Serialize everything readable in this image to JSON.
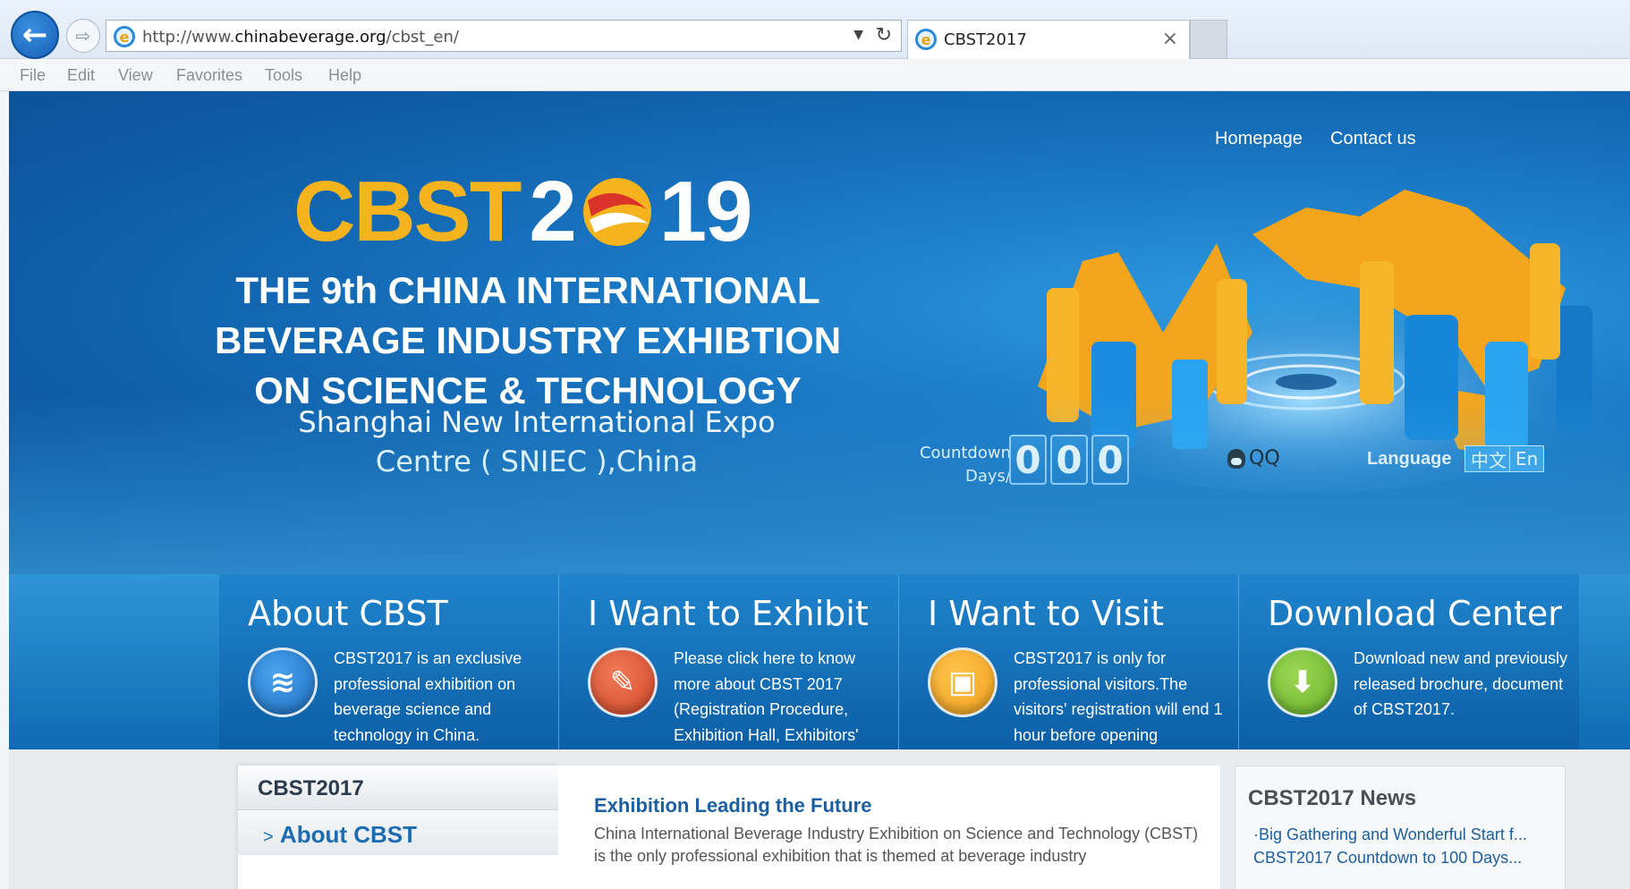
{
  "browser": {
    "url_prefix": "http://www.",
    "url_domain": "chinabeverage.org",
    "url_path": "/cbst_en/",
    "tab_title": "CBST2017",
    "menu": [
      "File",
      "Edit",
      "View",
      "Favorites",
      "Tools",
      "Help"
    ]
  },
  "header": {
    "nav": [
      "Homepage",
      "Contact us"
    ],
    "logo_cbst": "CBST",
    "logo_2": "2",
    "logo_19": "19",
    "headline_line1": "THE 9th CHINA INTERNATIONAL",
    "headline_line2": "BEVERAGE INDUSTRY EXHIBTION",
    "headline_line3": "ON SCIENCE & TECHNOLOGY",
    "venue_line1": "Shanghai New International Expo",
    "venue_line2": "Centre ( SNIEC ),China"
  },
  "countdown": {
    "label_line1": "Countdown",
    "label_line2": "Days/",
    "digits": [
      "0",
      "0",
      "0"
    ]
  },
  "contact": {
    "qq": "QQ"
  },
  "language": {
    "label": "Language",
    "options": [
      "中文",
      "En"
    ]
  },
  "features": [
    {
      "title": "About CBST",
      "icon": "swoosh-icon",
      "color": "#1e6fbf",
      "desc": "CBST2017 is an exclusive professional exhibition on beverage science and technology in China."
    },
    {
      "title": "I Want to Exhibit",
      "icon": "edit-icon",
      "color": "#d2482a",
      "desc": "Please click here to know more about CBST 2017 (Registration Procedure, Exhibition Hall, Exhibitors' Information, etc.)."
    },
    {
      "title": "I Want to Visit",
      "icon": "chair-icon",
      "color": "#f0a21c",
      "desc": "CBST2017 is only for professional visitors.The visitors' registration will end 1 hour before opening"
    },
    {
      "title": "Download Center",
      "icon": "download-icon",
      "color": "#6bb52c",
      "desc": "Download new and previously released brochure, document of CBST2017."
    }
  ],
  "sidebar": {
    "title": "CBST2017",
    "item": "About CBST",
    "item_marker": ">"
  },
  "article": {
    "title": "Exhibition Leading the Future",
    "body": "China International Beverage Industry Exhibition on Science and Technology (CBST) is the only professional exhibition that is themed at beverage industry"
  },
  "news": {
    "title": "CBST2017 News",
    "items": [
      "·Big Gathering and Wonderful Start f...",
      "CBST2017 Countdown to 100 Days..."
    ]
  }
}
